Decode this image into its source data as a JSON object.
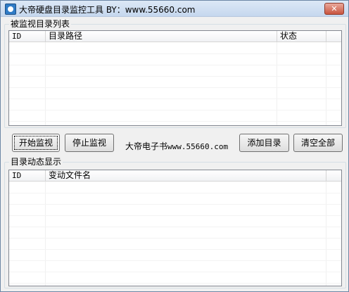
{
  "window": {
    "title": "大帝硬盘目录监控工具 BY：www.55660.com",
    "close_label": "✕"
  },
  "monitored": {
    "group_label": "被监视目录列表",
    "columns": [
      "ID",
      "目录路径",
      "状态"
    ]
  },
  "toolbar": {
    "start_label": "开始监视",
    "stop_label": "停止监视",
    "site_prefix": "大帝电子书",
    "site_url": "www.55660.com",
    "add_label": "添加目录",
    "clear_label": "清空全部"
  },
  "dynamic": {
    "group_label": "目录动态显示",
    "columns": [
      "ID",
      "变动文件名"
    ]
  },
  "icons": {
    "app": "app-icon",
    "close": "close-icon"
  }
}
